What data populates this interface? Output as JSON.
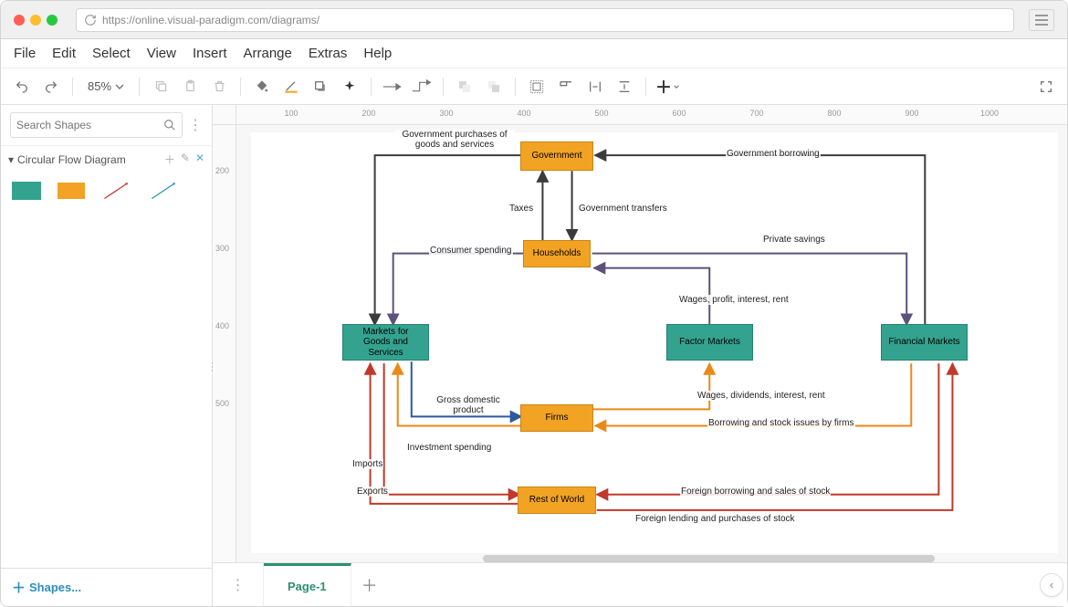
{
  "url": "https://online.visual-paradigm.com/diagrams/",
  "menu": {
    "items": [
      "File",
      "Edit",
      "Select",
      "View",
      "Insert",
      "Arrange",
      "Extras",
      "Help"
    ]
  },
  "toolbar": {
    "zoom": "85%"
  },
  "search": {
    "placeholder": "Search Shapes"
  },
  "palette": {
    "title": "Circular Flow Diagram"
  },
  "sidebar": {
    "more_shapes": "Shapes..."
  },
  "page_tab": "Page-1",
  "ruler_h": [
    100,
    200,
    300,
    400,
    500,
    600,
    700,
    800,
    900,
    1000
  ],
  "ruler_v": [
    200,
    300,
    400,
    500
  ],
  "nodes": {
    "government": "Government",
    "households": "Households",
    "firms": "Firms",
    "row": "Rest of World",
    "markets_goods": "Markets for Goods and Services",
    "factor": "Factor Markets",
    "financial": "Financial Markets"
  },
  "edges": {
    "gov_purchases": "Government purchases of goods and services",
    "gov_borrowing": "Government borrowing",
    "taxes": "Taxes",
    "gov_transfers": "Government transfers",
    "consumer_spending": "Consumer spending",
    "private_savings": "Private savings",
    "wages_profit": "Wages, profit, interest, rent",
    "wages_dividends": "Wages, dividends, interest, rent",
    "gdp": "Gross domestic product",
    "borrowing_firms": "Borrowing and stock issues by firms",
    "investment": "Investment spending",
    "imports": "Imports",
    "exports": "Exports",
    "foreign_borrowing": "Foreign borrowing and sales of stock",
    "foreign_lending": "Foreign lending and purchases of stock"
  },
  "chart_data": {
    "type": "diagram",
    "title": "Circular Flow Diagram",
    "nodes": [
      {
        "id": "government",
        "label": "Government",
        "kind": "agent"
      },
      {
        "id": "households",
        "label": "Households",
        "kind": "agent"
      },
      {
        "id": "firms",
        "label": "Firms",
        "kind": "agent"
      },
      {
        "id": "rest_of_world",
        "label": "Rest of World",
        "kind": "agent"
      },
      {
        "id": "markets_goods",
        "label": "Markets for Goods and Services",
        "kind": "market"
      },
      {
        "id": "factor_markets",
        "label": "Factor Markets",
        "kind": "market"
      },
      {
        "id": "financial_markets",
        "label": "Financial Markets",
        "kind": "market"
      }
    ],
    "edges": [
      {
        "from": "government",
        "to": "markets_goods",
        "label": "Government purchases of goods and services"
      },
      {
        "from": "financial_markets",
        "to": "government",
        "label": "Government borrowing"
      },
      {
        "from": "households",
        "to": "government",
        "label": "Taxes"
      },
      {
        "from": "government",
        "to": "households",
        "label": "Government transfers"
      },
      {
        "from": "households",
        "to": "markets_goods",
        "label": "Consumer spending"
      },
      {
        "from": "households",
        "to": "financial_markets",
        "label": "Private savings"
      },
      {
        "from": "factor_markets",
        "to": "households",
        "label": "Wages, profit, interest, rent"
      },
      {
        "from": "firms",
        "to": "factor_markets",
        "label": "Wages, dividends, interest, rent"
      },
      {
        "from": "markets_goods",
        "to": "firms",
        "label": "Gross domestic product"
      },
      {
        "from": "financial_markets",
        "to": "firms",
        "label": "Borrowing and stock issues by firms"
      },
      {
        "from": "firms",
        "to": "markets_goods",
        "label": "Investment spending"
      },
      {
        "from": "rest_of_world",
        "to": "markets_goods",
        "label": "Imports"
      },
      {
        "from": "markets_goods",
        "to": "rest_of_world",
        "label": "Exports"
      },
      {
        "from": "financial_markets",
        "to": "rest_of_world",
        "label": "Foreign borrowing and sales of stock"
      },
      {
        "from": "rest_of_world",
        "to": "financial_markets",
        "label": "Foreign lending and purchases of stock"
      }
    ]
  }
}
